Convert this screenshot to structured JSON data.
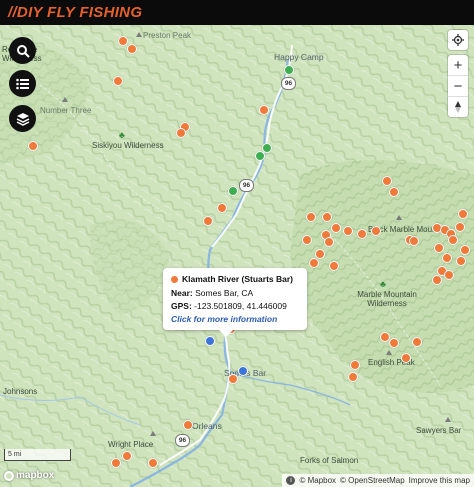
{
  "header": {
    "brand": "//DIY FLY FISHING"
  },
  "places": [
    {
      "name": "Preston Peak",
      "type": "peak"
    },
    {
      "name": "Happy Camp",
      "type": "town"
    },
    {
      "name": "Red Butte Wilderness",
      "type": "wilderness"
    },
    {
      "name": "Number Three",
      "type": "peak"
    },
    {
      "name": "Siskiyou Wilderness",
      "type": "wilderness"
    },
    {
      "name": "Black Marble Mountain",
      "type": "peak"
    },
    {
      "name": "Marble Mountain Wilderness",
      "type": "wilderness"
    },
    {
      "name": "English Peak",
      "type": "peak"
    },
    {
      "name": "Somes Bar",
      "type": "town"
    },
    {
      "name": "Orleans",
      "type": "town"
    },
    {
      "name": "Wright Place",
      "type": "place"
    },
    {
      "name": "Johnsons",
      "type": "place"
    },
    {
      "name": "Sawyers Bar",
      "type": "place"
    },
    {
      "name": "Forks of Salmon",
      "type": "place"
    }
  ],
  "route_shields": [
    "96",
    "96",
    "96"
  ],
  "popup": {
    "title": "Klamath River (Stuarts Bar)",
    "near_label": "Near:",
    "near_value": "Somes Bar, CA",
    "gps_label": "GPS:",
    "gps_value": "-123.501809, 41.446009",
    "more_link": "Click for more information",
    "marker_color": "#ef7a3a"
  },
  "controls": {
    "search_icon": "search-icon",
    "list_icon": "list-icon",
    "layers_icon": "layers-icon",
    "locate_icon": "locate-icon",
    "zoom_in": "+",
    "zoom_out": "−",
    "compass_icon": "compass-icon"
  },
  "scale_bar": {
    "label": "5 mi"
  },
  "footer": {
    "logo_text": "mapbox",
    "attribution_copyright": "© Mapbox",
    "attribution_osm": "© OpenStreetMap",
    "attribution_improve": "Improve this map"
  },
  "legend_colors": {
    "fishing_spot": "#ef7a3a",
    "campground": "#3fae52",
    "access_point": "#3a74d8",
    "brand": "#e4612d"
  }
}
